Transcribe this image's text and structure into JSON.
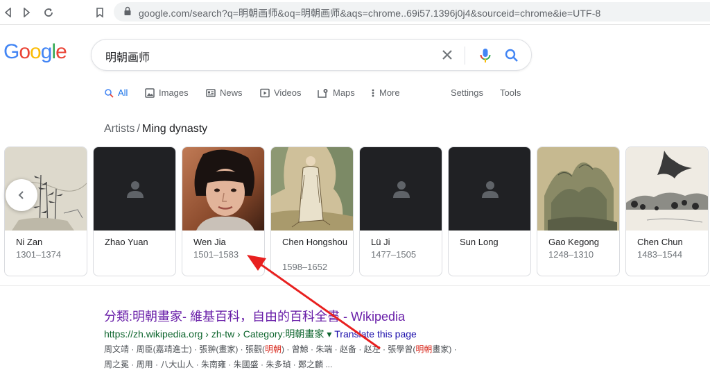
{
  "browser": {
    "url": "google.com/search?q=明朝画师&oq=明朝画师&aqs=chrome..69i57.1396j0j4&sourceid=chrome&ie=UTF-8"
  },
  "logo": {
    "letters": [
      "G",
      "o",
      "o",
      "g",
      "l",
      "e"
    ],
    "colors": [
      "#4285f4",
      "#ea4335",
      "#fbbc05",
      "#4285f4",
      "#34a853",
      "#ea4335"
    ]
  },
  "search": {
    "query": "明朝画师"
  },
  "tabs": [
    {
      "label": "All",
      "icon": "search-icon",
      "active": true
    },
    {
      "label": "Images",
      "icon": "image-icon"
    },
    {
      "label": "News",
      "icon": "news-icon"
    },
    {
      "label": "Videos",
      "icon": "video-icon"
    },
    {
      "label": "Maps",
      "icon": "map-icon"
    },
    {
      "label": "More",
      "icon": "more-icon"
    },
    {
      "label": "Settings"
    },
    {
      "label": "Tools"
    }
  ],
  "carousel": {
    "breadcrumb": "Artists",
    "separator": "/",
    "title": "Ming dynasty",
    "cards": [
      {
        "name": "Ni Zan",
        "years": "1301–1374",
        "image": "landscape-bamboo"
      },
      {
        "name": "Zhao Yuan",
        "years": "",
        "image": "placeholder"
      },
      {
        "name": "Wen Jia",
        "years": "1501–1583",
        "image": "photo-person"
      },
      {
        "name": "Chen Hongshou",
        "years": "1598–1652",
        "image": "figure-painting"
      },
      {
        "name": "Lü Ji",
        "years": "1477–1505",
        "image": "placeholder"
      },
      {
        "name": "Sun Long",
        "years": "",
        "image": "placeholder"
      },
      {
        "name": "Gao Kegong",
        "years": "1248–1310",
        "image": "mountain-painting"
      },
      {
        "name": "Chen Chun",
        "years": "1483–1544",
        "image": "ink-landscape"
      }
    ]
  },
  "result": {
    "title": "分類:明朝畫家- 維基百科，自由的百科全書 - Wikipedia",
    "url": "https://zh.wikipedia.org › zh-tw › Category:明朝畫家",
    "dropdown": "▾",
    "translate": "Translate this page",
    "snippet1_a": "周文靖 · 周臣(嘉靖進士) · 張翀(畫家) · 張觀(",
    "snippet1_hl1": "明朝",
    "snippet1_b": ") · 曾鯨 · 朱端 · 赵备 · 赵左 · 張學曾(",
    "snippet1_hl2": "明朝",
    "snippet1_c": "畫家) ·",
    "snippet2": "周之冕 · 周用 · 八大山人 · 朱南雍 · 朱國盛 · 朱多𤦹 · 鄭之麟 ..."
  }
}
